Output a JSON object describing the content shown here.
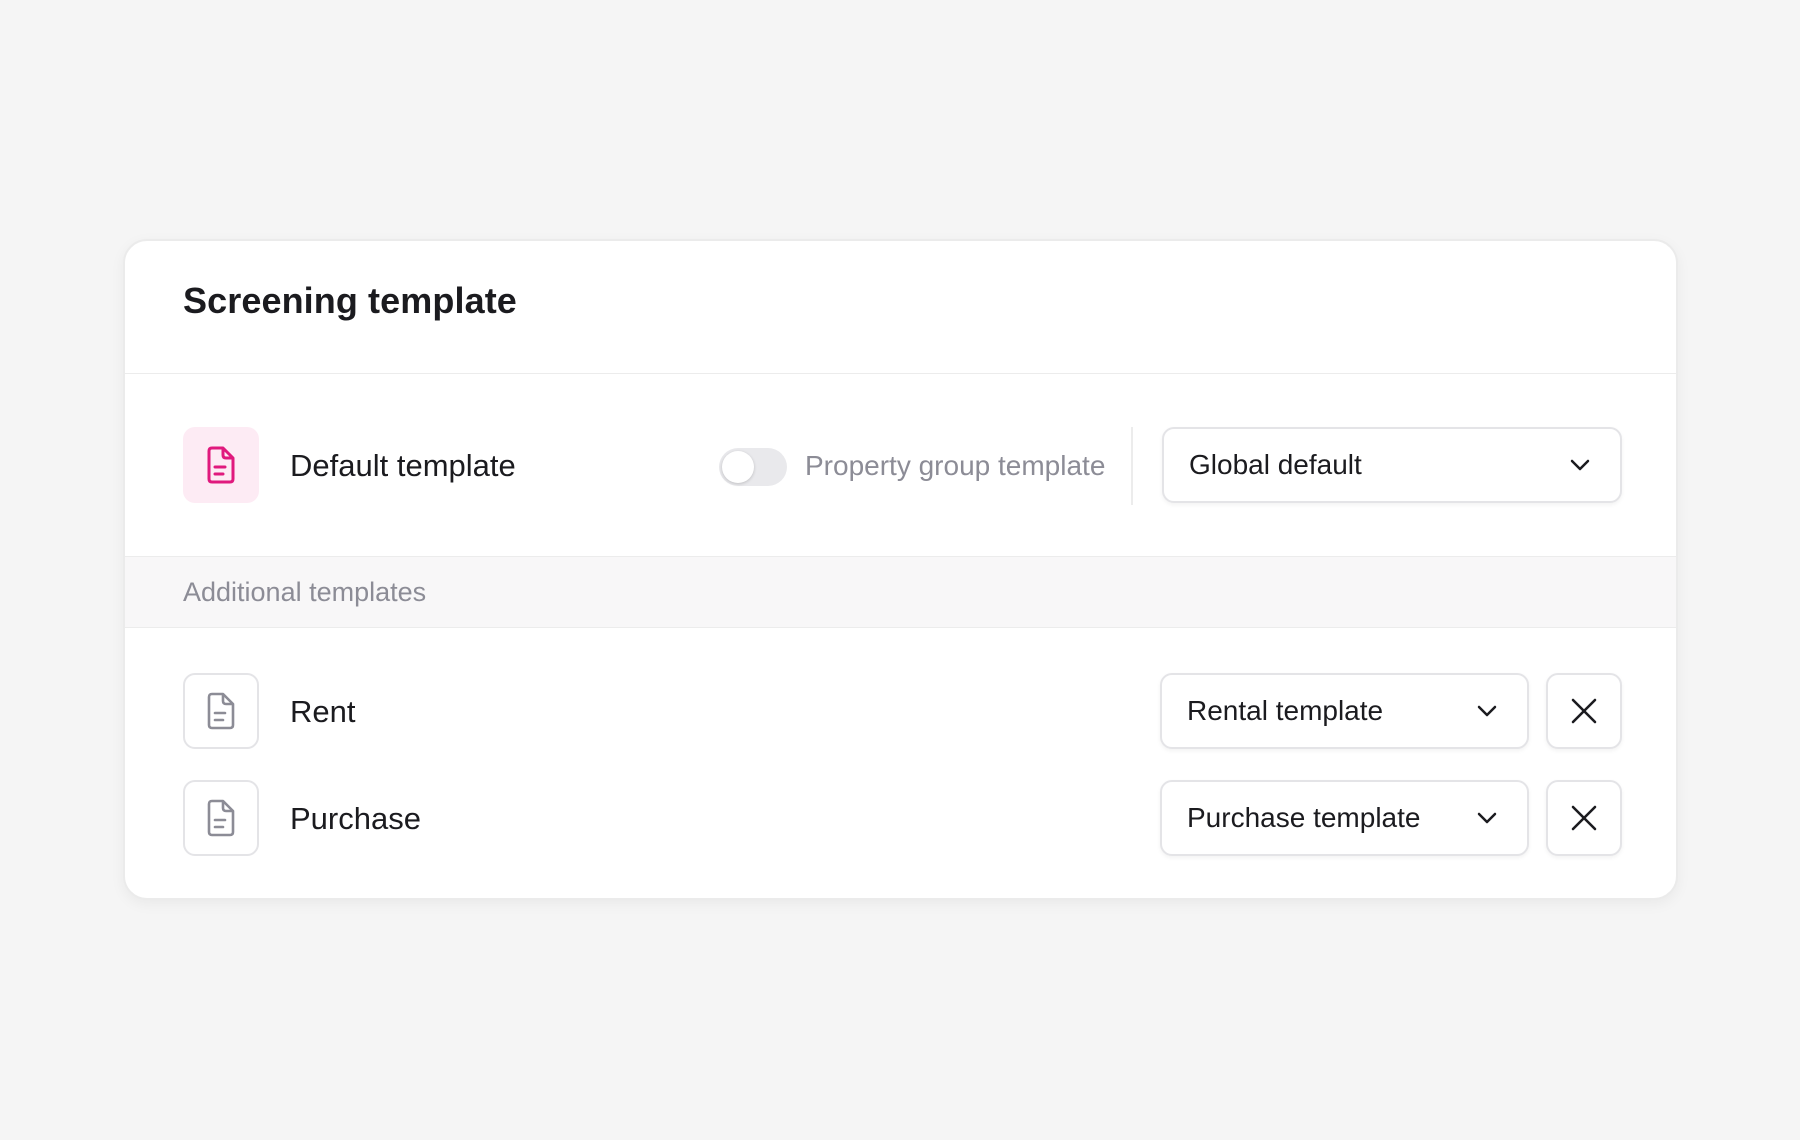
{
  "card": {
    "title": "Screening template"
  },
  "default_template": {
    "icon": "document-icon",
    "label": "Default template",
    "toggle": {
      "label": "Property group template",
      "checked": false
    },
    "select_value": "Global default"
  },
  "additional": {
    "section_title": "Additional templates",
    "items": [
      {
        "icon": "document-icon",
        "label": "Rent",
        "select_value": "Rental template",
        "remove_icon": "close-icon"
      },
      {
        "icon": "document-icon",
        "label": "Purchase",
        "select_value": "Purchase template",
        "remove_icon": "close-icon"
      }
    ]
  },
  "colors": {
    "accent": "#e0197d",
    "accent_bg": "#fdebf4",
    "icon_gray": "#8c8c96",
    "text": "#1b1b1f",
    "muted_text": "#8c8c96",
    "page_bg": "#f5f5f5",
    "border": "#e4e4e7"
  }
}
